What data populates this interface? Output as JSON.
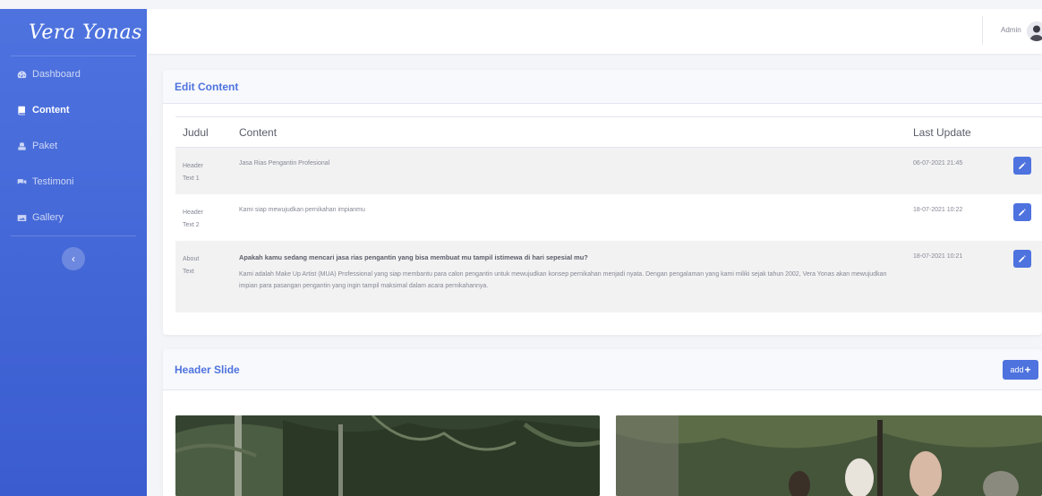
{
  "brand": {
    "name": "Vera Yonas"
  },
  "sidebar": {
    "items": [
      {
        "label": "Dashboard",
        "icon": "tachometer-icon",
        "active": false
      },
      {
        "label": "Content",
        "icon": "book-icon",
        "active": true
      },
      {
        "label": "Paket",
        "icon": "box-icon",
        "active": false
      },
      {
        "label": "Testimoni",
        "icon": "comments-icon",
        "active": false
      },
      {
        "label": "Gallery",
        "icon": "image-icon",
        "active": false
      }
    ],
    "toggle_icon": "chevron-left-icon"
  },
  "topbar": {
    "admin_name": "Admin"
  },
  "edit_content": {
    "title": "Edit Content",
    "columns": {
      "judul": "Judul",
      "content": "Content",
      "last_update": "Last Update"
    },
    "rows": [
      {
        "judul_1": "Header",
        "judul_2": "Text 1",
        "content": "Jasa Rias Pengantin Profesional",
        "last_update": "06-07-2021 21:45"
      },
      {
        "judul_1": "Header",
        "judul_2": "Text 2",
        "content": "Kami siap mewujudkan pernikahan impianmu",
        "last_update": "18-07-2021 10:22"
      },
      {
        "judul_1": "About",
        "judul_2": "Text",
        "content_title": "Apakah kamu sedang mencari jasa rias pengantin yang bisa membuat mu tampil istimewa di hari sepesial mu?",
        "content": "Kami adalah Make Up Artist (MUA) Professional yang siap membantu para calon pengantin untuk mewujudkan konsep pernikahan menjadi nyata. Dengan pengalaman yang kami miliki sejak tahun 2002, Vera Yonas akan mewujudkan impian para pasangan pengantin yang ingin tampil maksimal dalam acara pernikahannya.",
        "last_update": "18-07-2021 10:21"
      }
    ]
  },
  "header_slide": {
    "title": "Header Slide",
    "add_label": "add",
    "add_symbol": "+"
  },
  "colors": {
    "primary": "#4e73df",
    "sidebar": "#4e73df",
    "background": "#f4f5f9"
  }
}
